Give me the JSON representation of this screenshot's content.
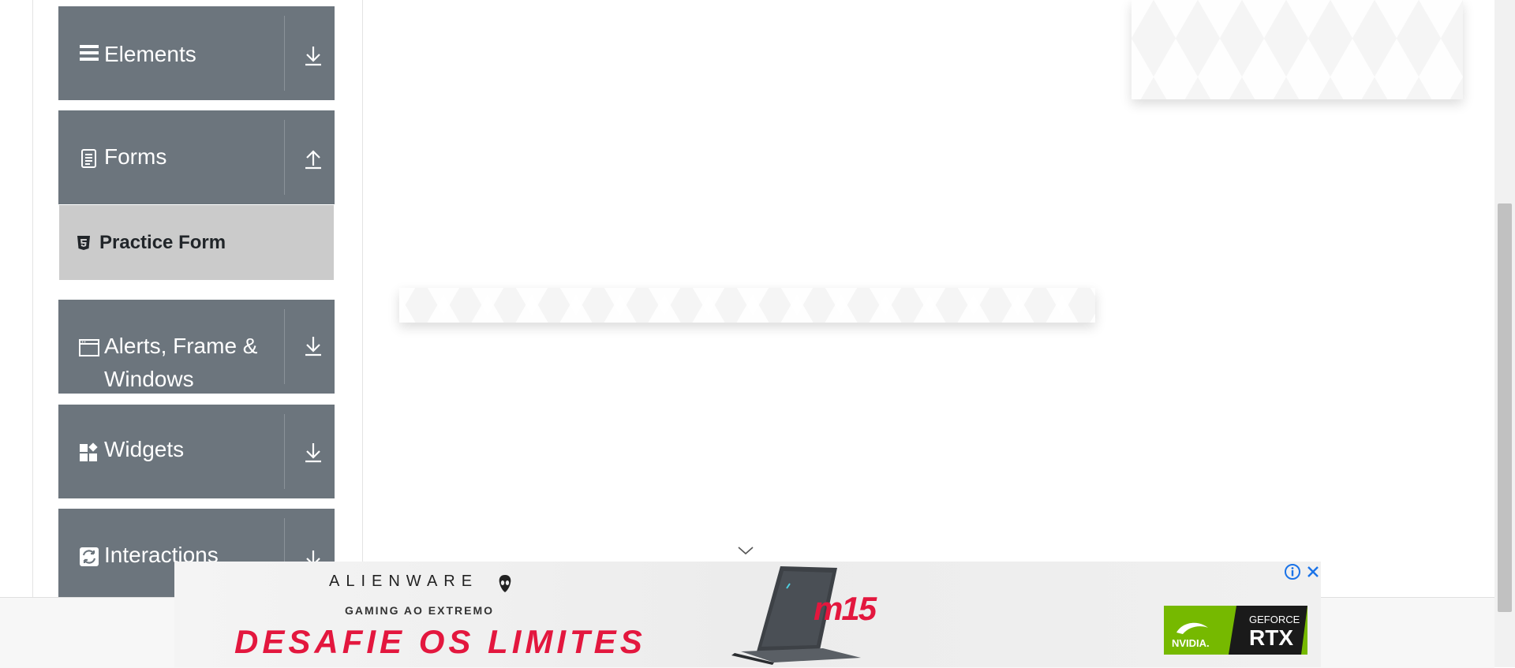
{
  "sidebar": {
    "groups": [
      {
        "label": "Elements",
        "icon": "hamburger-icon",
        "arrow": "download-arrow-icon"
      },
      {
        "label": "Forms",
        "icon": "document-icon",
        "arrow": "upload-arrow-icon"
      },
      {
        "label": "Alerts, Frame & Windows",
        "icon": "window-icon",
        "arrow": "download-arrow-icon"
      },
      {
        "label": "Widgets",
        "icon": "widgets-icon",
        "arrow": "download-arrow-icon"
      },
      {
        "label": "Interactions",
        "icon": "interactions-icon",
        "arrow": "download-arrow-icon"
      }
    ],
    "sub_items": [
      {
        "label": "Practice Form",
        "icon": "html5-icon"
      }
    ]
  },
  "ad": {
    "brand": "ALIENWARE",
    "tagline": "GAMING AO EXTREMO",
    "headline": "DESAFIE OS LIMITES",
    "model": "m15",
    "badge_top": "GEFORCE",
    "badge_main": "RTX",
    "badge_brand": "NVIDIA.",
    "colors": {
      "headline": "#e3173e",
      "nvidia_green": "#76b900"
    }
  },
  "colors": {
    "group_bg": "#6c757d",
    "subitem_bg": "#cbcbcb",
    "page_bg": "#ffffff"
  }
}
